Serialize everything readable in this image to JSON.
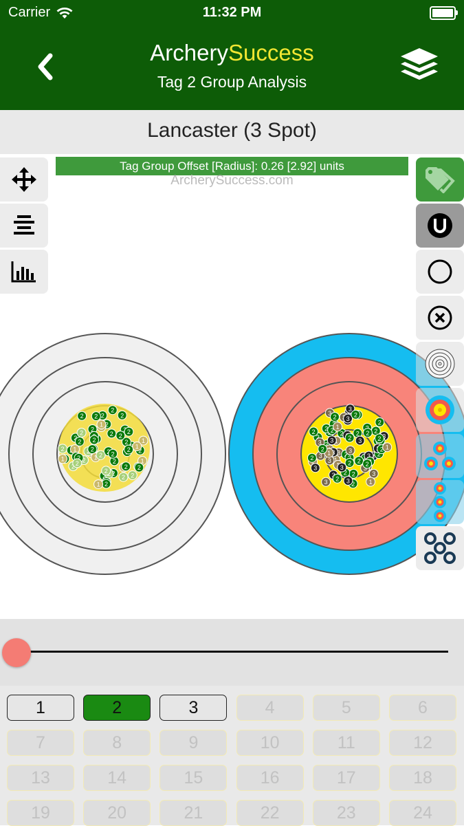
{
  "status": {
    "carrier": "Carrier",
    "time": "11:32 PM"
  },
  "header": {
    "title_part1": "Archery",
    "title_part2": "Success",
    "subtitle": "Tag 2 Group Analysis"
  },
  "round": {
    "name": "Lancaster (3 Spot)"
  },
  "canvas": {
    "offset_text": "Tag Group Offset [Radius]: 0.26 [2.92] units",
    "watermark": "ArcherySuccess.com"
  },
  "left_tools": [
    "move-tool",
    "align-tool",
    "histogram-tool"
  ],
  "right_tools": [
    "tag-filter",
    "unit-toggle",
    "circle-view",
    "cross-view",
    "rings-view",
    "full-face-target",
    "triangle-3-spot",
    "vertical-3-spot",
    "multi-spot"
  ],
  "slider": {
    "value": 0
  },
  "ends": [
    {
      "label": "1",
      "state": "enabled"
    },
    {
      "label": "2",
      "state": "active"
    },
    {
      "label": "3",
      "state": "enabled"
    },
    {
      "label": "4",
      "state": "disabled"
    },
    {
      "label": "5",
      "state": "disabled"
    },
    {
      "label": "6",
      "state": "disabled"
    },
    {
      "label": "7",
      "state": "disabled"
    },
    {
      "label": "8",
      "state": "disabled"
    },
    {
      "label": "9",
      "state": "disabled"
    },
    {
      "label": "10",
      "state": "disabled"
    },
    {
      "label": "11",
      "state": "disabled"
    },
    {
      "label": "12",
      "state": "disabled"
    },
    {
      "label": "13",
      "state": "disabled"
    },
    {
      "label": "14",
      "state": "disabled"
    },
    {
      "label": "15",
      "state": "disabled"
    },
    {
      "label": "16",
      "state": "disabled"
    },
    {
      "label": "17",
      "state": "disabled"
    },
    {
      "label": "18",
      "state": "disabled"
    },
    {
      "label": "19",
      "state": "disabled"
    },
    {
      "label": "20",
      "state": "disabled"
    },
    {
      "label": "21",
      "state": "disabled"
    },
    {
      "label": "22",
      "state": "disabled"
    },
    {
      "label": "23",
      "state": "disabled"
    },
    {
      "label": "24",
      "state": "disabled"
    }
  ],
  "colors": {
    "header_green": "#0d5c07",
    "accent_yellow": "#f2e632",
    "active_end": "#1a8a12",
    "offset_bar": "#3f9a3c",
    "slider_knob": "#f47c74"
  }
}
